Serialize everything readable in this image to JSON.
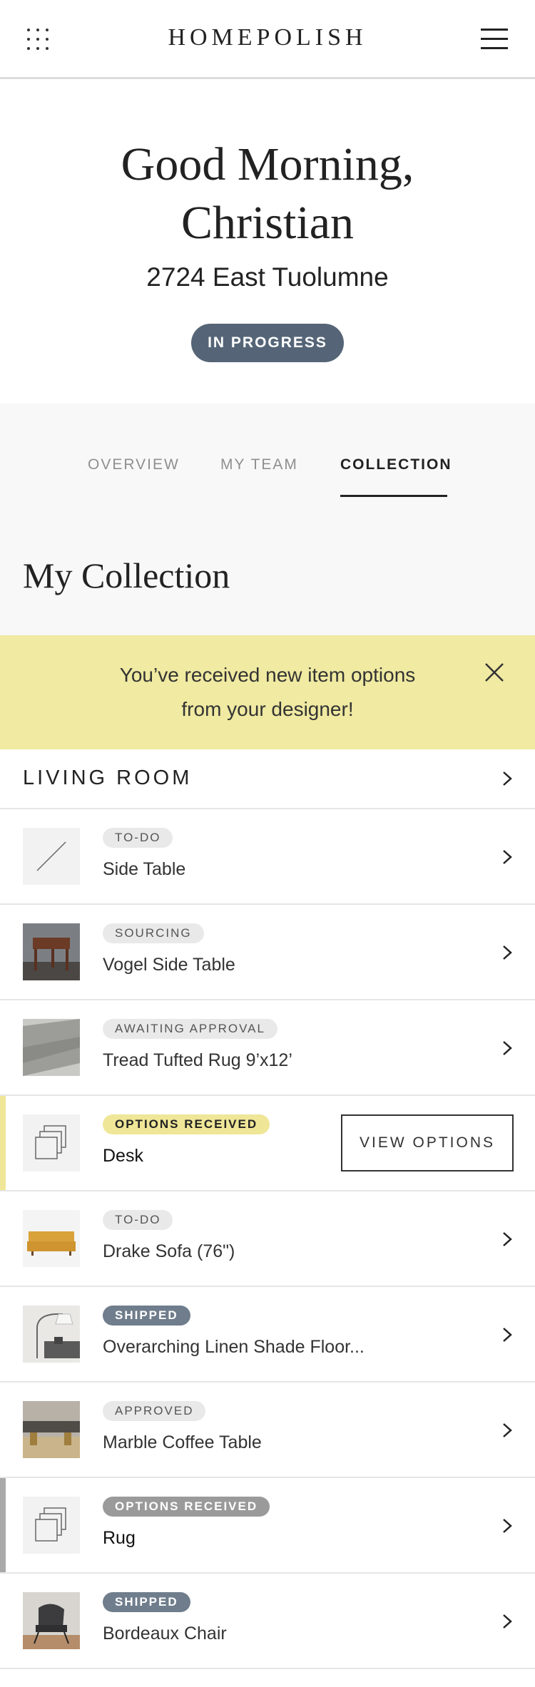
{
  "header": {
    "brand": "HOMEPOLISH"
  },
  "hero": {
    "greeting_line1": "Good Morning,",
    "greeting_line2": "Christian",
    "address": "2724 East Tuolumne",
    "status": "IN PROGRESS"
  },
  "tabs": [
    {
      "label": "OVERVIEW"
    },
    {
      "label": "MY TEAM"
    },
    {
      "label": "COLLECTION"
    }
  ],
  "active_tab": "COLLECTION",
  "collection": {
    "title": "My Collection",
    "banner": {
      "line1": "You’ve received new item options",
      "line2": "from your designer!"
    },
    "room": "LIVING ROOM",
    "view_options_label": "VIEW OPTIONS",
    "items": [
      {
        "status": "TO-DO",
        "name": "Side Table",
        "thumb": "placeholder"
      },
      {
        "status": "SOURCING",
        "name": "Vogel Side Table",
        "thumb": "side-table-photo"
      },
      {
        "status": "AWAITING APPROVAL",
        "name": "Tread Tufted Rug 9’x12’",
        "thumb": "rug-photo"
      },
      {
        "status": "OPTIONS RECEIVED",
        "name": "Desk",
        "thumb": "options-stack-icon"
      },
      {
        "status": "TO-DO",
        "name": "Drake Sofa (76\")",
        "thumb": "sofa-photo"
      },
      {
        "status": "SHIPPED",
        "name": "Overarching Linen Shade Floor...",
        "thumb": "floor-lamp-photo"
      },
      {
        "status": "APPROVED",
        "name": "Marble Coffee Table",
        "thumb": "coffee-table-photo"
      },
      {
        "status": "OPTIONS RECEIVED",
        "name": "Rug",
        "thumb": "options-stack-icon"
      },
      {
        "status": "SHIPPED",
        "name": "Bordeaux Chair",
        "thumb": "chair-photo"
      }
    ]
  },
  "colors": {
    "status_pill": "#556577",
    "banner": "#f0eaa2",
    "accent_yellow": "#efe697",
    "accent_gray": "#a9a9a9",
    "badge_dark": "#6f7d8c"
  }
}
